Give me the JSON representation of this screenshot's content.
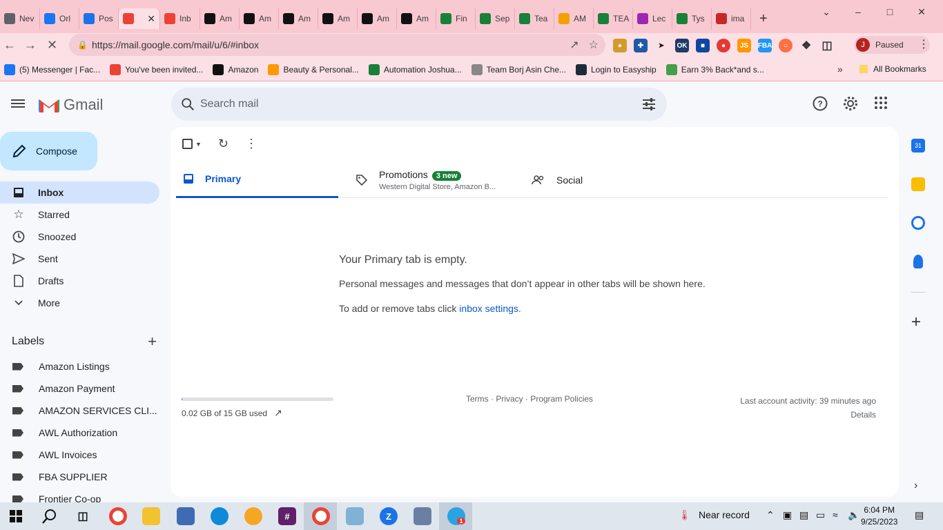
{
  "browser": {
    "tabs": [
      {
        "title": "Nev",
        "icon": "chrome-icon",
        "color": "#5f6368"
      },
      {
        "title": "Orl",
        "icon": "facebook-icon",
        "color": "#1877f2"
      },
      {
        "title": "Pos",
        "icon": "zoho-icon",
        "color": "#1a73e8"
      },
      {
        "title": "",
        "icon": "gmail-icon",
        "color": "#ea4335",
        "active": true
      },
      {
        "title": "Inb",
        "icon": "gmail-icon",
        "color": "#ea4335"
      },
      {
        "title": "Am",
        "icon": "amazon-icon",
        "color": "#111111"
      },
      {
        "title": "Am",
        "icon": "amazon-icon",
        "color": "#111111"
      },
      {
        "title": "Am",
        "icon": "amazon-icon",
        "color": "#111111"
      },
      {
        "title": "Am",
        "icon": "amazon-icon",
        "color": "#111111"
      },
      {
        "title": "Am",
        "icon": "amazon-icon",
        "color": "#111111"
      },
      {
        "title": "Am",
        "icon": "amazon-icon",
        "color": "#111111"
      },
      {
        "title": "Fin",
        "icon": "sheets-icon",
        "color": "#188038"
      },
      {
        "title": "Sep",
        "icon": "sheets-icon",
        "color": "#188038"
      },
      {
        "title": "Tea",
        "icon": "sheets-icon",
        "color": "#188038"
      },
      {
        "title": "AM",
        "icon": "pen-icon",
        "color": "#f4a100"
      },
      {
        "title": "TEA",
        "icon": "sheets-icon",
        "color": "#188038"
      },
      {
        "title": "Lec",
        "icon": "lecture-icon",
        "color": "#9c27b0"
      },
      {
        "title": "Tys",
        "icon": "sheets-icon",
        "color": "#188038"
      },
      {
        "title": "ima",
        "icon": "vivaldi-icon",
        "color": "#c62828"
      }
    ],
    "url": "https://mail.google.com/mail/u/6/#inbox",
    "profile_initial": "J",
    "profile_status": "Paused",
    "bookmarks": [
      {
        "label": "(5) Messenger | Fac...",
        "icon": "facebook-icon",
        "color": "#1877f2"
      },
      {
        "label": "You've been invited...",
        "icon": "gmail-icon",
        "color": "#ea4335"
      },
      {
        "label": "Amazon",
        "icon": "amazon-icon",
        "color": "#111111"
      },
      {
        "label": "Beauty & Personal...",
        "icon": "amazon-smile-icon",
        "color": "#f90"
      },
      {
        "label": "Automation Joshua...",
        "icon": "sheets-icon",
        "color": "#188038"
      },
      {
        "label": "Team Borj Asin Che...",
        "icon": "team-icon",
        "color": "#888888"
      },
      {
        "label": "Login to Easyship",
        "icon": "easyship-icon",
        "color": "#1c2b3a"
      },
      {
        "label": "Earn 3% Back*and s...",
        "icon": "cashback-icon",
        "color": "#43a047"
      }
    ],
    "all_bookmarks": "All Bookmarks"
  },
  "gmail": {
    "app_name": "Gmail",
    "search_placeholder": "Search mail",
    "compose_label": "Compose",
    "nav": [
      {
        "label": "Inbox",
        "icon": "inbox-icon",
        "active": true
      },
      {
        "label": "Starred",
        "icon": "star-icon"
      },
      {
        "label": "Snoozed",
        "icon": "clock-icon"
      },
      {
        "label": "Sent",
        "icon": "send-icon"
      },
      {
        "label": "Drafts",
        "icon": "draft-icon"
      },
      {
        "label": "More",
        "icon": "chevron-down-icon"
      }
    ],
    "labels_heading": "Labels",
    "labels": [
      "Amazon Listings",
      "Amazon Payment",
      "AMAZON SERVICES CLI...",
      "AWL Authorization",
      "AWL Invoices",
      "FBA SUPPLIER",
      "Frontier Co-op"
    ],
    "tabs": {
      "primary": "Primary",
      "promotions": "Promotions",
      "promotions_badge": "3 new",
      "promotions_sub": "Western Digital Store, Amazon B...",
      "social": "Social"
    },
    "empty": {
      "title": "Your Primary tab is empty.",
      "desc": "Personal messages and messages that don’t appear in other tabs will be shown here.",
      "hint_prefix": "To add or remove tabs click ",
      "hint_link": "inbox settings",
      "hint_suffix": "."
    },
    "storage": {
      "text": "0.02 GB of 15 GB used",
      "used_fraction": 0.0013
    },
    "footer_links": "Terms · Privacy · Program Policies",
    "activity": "Last account activity: 39 minutes ago",
    "details": "Details"
  },
  "taskbar": {
    "weather": "Near record",
    "time": "6:04 PM",
    "date": "9/25/2023",
    "telegram_badge": "1"
  },
  "colors": {
    "accent": "#0b57d0",
    "compose_bg": "#c2e7ff",
    "inbox_active": "#d3e3fd",
    "chrome_pink": "#f9c9d2"
  }
}
